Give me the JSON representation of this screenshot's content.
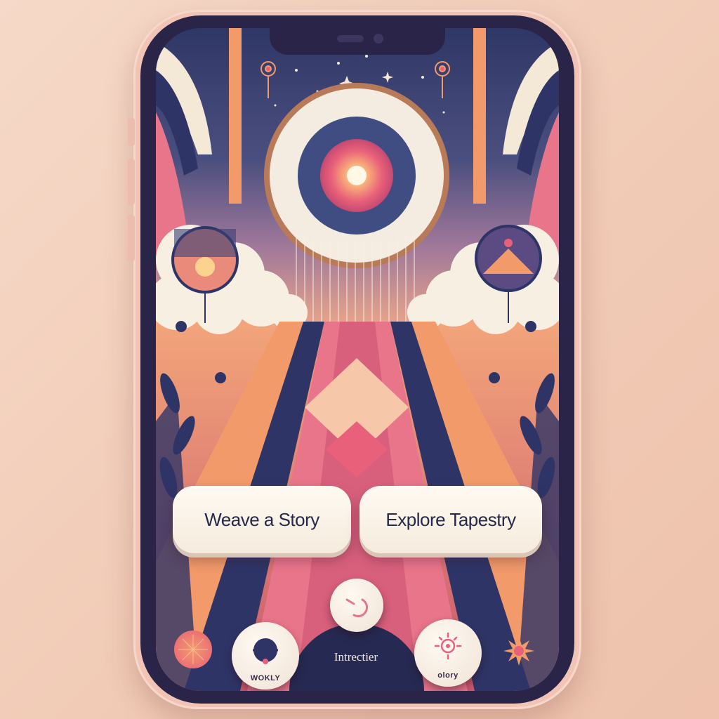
{
  "actions": {
    "weave_label": "Weave a Story",
    "explore_label": "Explore Tapestry"
  },
  "nav": {
    "left_tab_label": "WOKLY",
    "center_label": "Intrectier",
    "right_tab_label": "olory"
  },
  "icons": {
    "play": "play-arc-icon",
    "yarn": "yarn-ball-icon",
    "sun": "sun-rays-icon",
    "sunburst": "sunburst-icon",
    "sunset_orb": "sunset-orb-icon"
  },
  "colors": {
    "frame": "#2a2448",
    "button_bg": "#fffaf2",
    "button_text": "#27284a",
    "accent_pink": "#e9607a",
    "accent_navy": "#2e3566",
    "accent_orange": "#f29a6a"
  }
}
